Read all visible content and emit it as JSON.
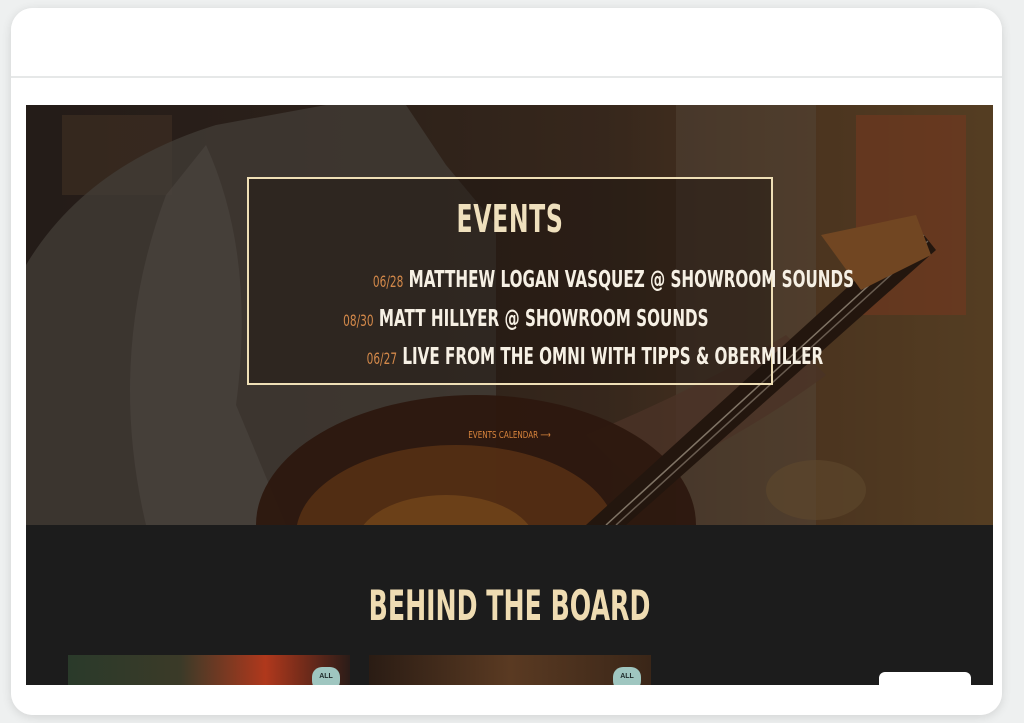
{
  "events": {
    "title": "EVENTS",
    "items": [
      {
        "date": "06/28",
        "title": "MATTHEW LOGAN VASQUEZ @ SHOWROOM SOUNDS"
      },
      {
        "date": "08/30",
        "title": "MATT HILLYER @ SHOWROOM SOUNDS"
      },
      {
        "date": "06/27",
        "title": "LIVE FROM THE OMNI WITH TIPPS & OBERMILLER"
      }
    ],
    "calendar_link": "EVENTS CALENDAR ⟶"
  },
  "behind_the_board": {
    "title": "BEHIND THE BOARD",
    "cards": [
      {
        "badge": "ALL"
      },
      {
        "badge": "ALL"
      }
    ]
  },
  "colors": {
    "accent": "#d8843c",
    "heading": "#efdcb2",
    "dark_section": "#1c1c1c"
  }
}
